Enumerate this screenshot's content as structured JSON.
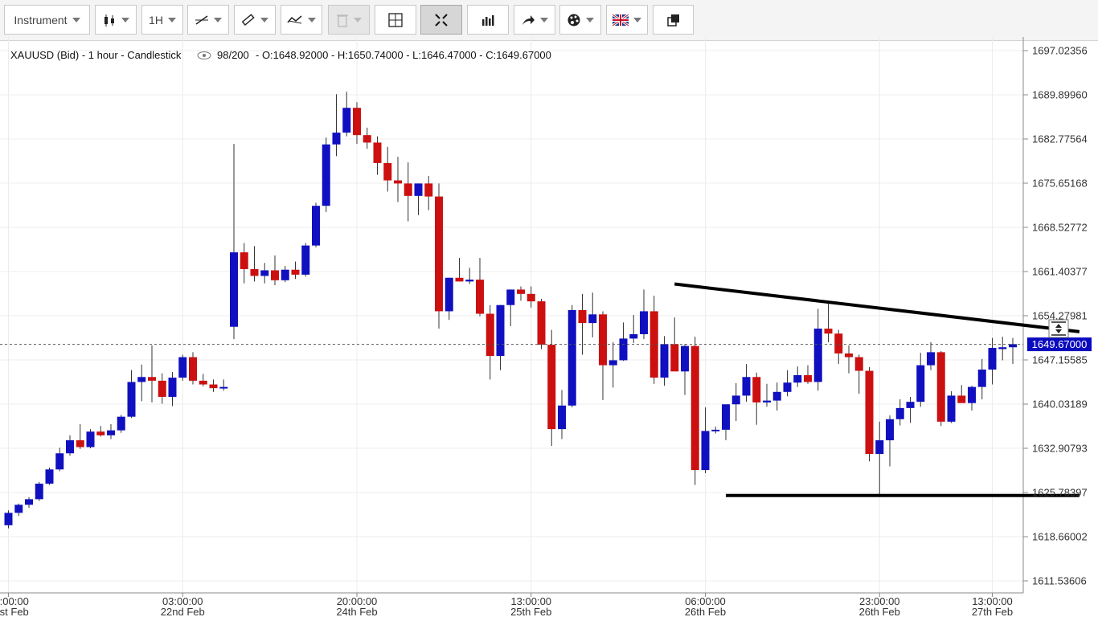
{
  "toolbar": {
    "instrument_label": "Instrument",
    "timeframe_label": "1H",
    "items": [
      "candle-style-icon",
      "line-tool-icon",
      "ruler-icon",
      "indicator-icon",
      "trash-icon",
      "crosshair-icon",
      "fullscreen-icon",
      "bars-icon",
      "arrow-icon",
      "palette-icon",
      "uk-flag-icon",
      "windows-icon"
    ]
  },
  "chart_info": {
    "header": "XAUUSD (Bid) - 1 hour - Candlestick",
    "counter": "98/200",
    "ohlc": "- O:1648.92000 - H:1650.74000 - L:1646.47000 - C:1649.67000"
  },
  "chart_data": {
    "type": "candlestick",
    "title": "XAUUSD (Bid) - 1 hour - Candlestick",
    "ylim": [
      1608,
      1700
    ],
    "y_ticks": [
      1697.02356,
      1689.8996,
      1682.77564,
      1675.65168,
      1668.52772,
      1661.40377,
      1654.27981,
      1647.15585,
      1640.03189,
      1632.90793,
      1625.78397,
      1618.66002,
      1611.53606
    ],
    "x_ticks": [
      {
        "time": "10:00:00",
        "date": "21st Feb",
        "index": 0
      },
      {
        "time": "03:00:00",
        "date": "22nd Feb",
        "index": 17
      },
      {
        "time": "20:00:00",
        "date": "24th Feb",
        "index": 34
      },
      {
        "time": "13:00:00",
        "date": "25th Feb",
        "index": 51
      },
      {
        "time": "06:00:00",
        "date": "26th Feb",
        "index": 68
      },
      {
        "time": "23:00:00",
        "date": "26th Feb",
        "index": 85
      },
      {
        "time": "13:00:00",
        "date": "27th Feb",
        "index": 96
      }
    ],
    "current_price": 1649.67,
    "current_price_label": "1649.67000",
    "up_color": "#1010c0",
    "down_color": "#cc1010",
    "candles": [
      [
        1620.5,
        1622.9,
        1620.0,
        1622.5
      ],
      [
        1622.5,
        1624.0,
        1622.0,
        1623.8
      ],
      [
        1623.8,
        1625.0,
        1623.3,
        1624.7
      ],
      [
        1624.7,
        1627.5,
        1624.4,
        1627.2
      ],
      [
        1627.2,
        1629.8,
        1627.0,
        1629.5
      ],
      [
        1629.5,
        1633.0,
        1629.2,
        1632.1
      ],
      [
        1632.1,
        1635.0,
        1631.7,
        1634.2
      ],
      [
        1634.2,
        1636.8,
        1632.8,
        1633.1
      ],
      [
        1633.1,
        1636.0,
        1632.9,
        1635.6
      ],
      [
        1635.6,
        1636.5,
        1634.8,
        1635.0
      ],
      [
        1635.0,
        1636.8,
        1634.4,
        1635.8
      ],
      [
        1635.8,
        1638.3,
        1635.4,
        1638.0
      ],
      [
        1638.0,
        1645.5,
        1637.8,
        1643.6
      ],
      [
        1643.6,
        1646.4,
        1640.5,
        1644.4
      ],
      [
        1644.4,
        1649.5,
        1640.3,
        1643.8
      ],
      [
        1643.8,
        1645.0,
        1640.1,
        1641.2
      ],
      [
        1641.2,
        1645.2,
        1639.7,
        1644.3
      ],
      [
        1644.3,
        1648.0,
        1643.8,
        1647.6
      ],
      [
        1647.6,
        1648.4,
        1643.2,
        1643.8
      ],
      [
        1643.8,
        1644.9,
        1642.9,
        1643.2
      ],
      [
        1643.2,
        1644.0,
        1642.0,
        1642.6
      ],
      [
        1642.6,
        1644.0,
        1642.2,
        1642.8
      ],
      [
        1652.5,
        1682.0,
        1650.5,
        1664.5
      ],
      [
        1664.5,
        1666.0,
        1659.5,
        1661.8
      ],
      [
        1661.8,
        1665.5,
        1659.8,
        1660.7
      ],
      [
        1660.7,
        1662.8,
        1659.5,
        1661.6
      ],
      [
        1661.6,
        1664.0,
        1659.2,
        1660.0
      ],
      [
        1660.0,
        1662.3,
        1659.7,
        1661.7
      ],
      [
        1661.7,
        1663.0,
        1660.2,
        1660.9
      ],
      [
        1660.9,
        1666.0,
        1660.6,
        1665.6
      ],
      [
        1665.6,
        1672.5,
        1665.3,
        1672.0
      ],
      [
        1672.0,
        1683.0,
        1671.0,
        1681.9
      ],
      [
        1681.9,
        1690.0,
        1680.0,
        1683.8
      ],
      [
        1683.8,
        1690.4,
        1683.2,
        1687.8
      ],
      [
        1687.8,
        1688.7,
        1682.0,
        1683.4
      ],
      [
        1683.4,
        1684.6,
        1681.2,
        1682.2
      ],
      [
        1682.2,
        1683.2,
        1677.0,
        1678.9
      ],
      [
        1678.9,
        1681.5,
        1674.3,
        1676.1
      ],
      [
        1676.1,
        1679.9,
        1672.6,
        1675.6
      ],
      [
        1675.6,
        1679.0,
        1669.5,
        1673.6
      ],
      [
        1673.6,
        1675.6,
        1670.5,
        1675.6
      ],
      [
        1675.6,
        1676.8,
        1671.3,
        1673.5
      ],
      [
        1673.5,
        1675.6,
        1652.2,
        1655.0
      ],
      [
        1655.0,
        1660.4,
        1653.6,
        1660.4
      ],
      [
        1660.4,
        1663.6,
        1659.8,
        1659.8
      ],
      [
        1659.8,
        1662.0,
        1659.4,
        1660.1
      ],
      [
        1660.1,
        1663.6,
        1654.2,
        1654.6
      ],
      [
        1654.6,
        1656.0,
        1644.0,
        1647.8
      ],
      [
        1647.8,
        1656.0,
        1645.5,
        1656.0
      ],
      [
        1656.0,
        1658.5,
        1652.6,
        1658.5
      ],
      [
        1658.5,
        1659.0,
        1656.7,
        1657.8
      ],
      [
        1657.8,
        1659.0,
        1655.6,
        1656.6
      ],
      [
        1656.6,
        1657.0,
        1648.9,
        1649.6
      ],
      [
        1649.6,
        1652.0,
        1633.3,
        1636.0
      ],
      [
        1636.0,
        1642.3,
        1634.4,
        1639.8
      ],
      [
        1639.8,
        1656.0,
        1639.5,
        1655.2
      ],
      [
        1655.2,
        1657.8,
        1648.0,
        1653.1
      ],
      [
        1653.1,
        1658.0,
        1650.8,
        1654.5
      ],
      [
        1654.5,
        1655.0,
        1640.7,
        1646.3
      ],
      [
        1646.3,
        1650.0,
        1642.7,
        1647.1
      ],
      [
        1647.1,
        1653.2,
        1647.0,
        1650.6
      ],
      [
        1650.6,
        1654.4,
        1649.9,
        1651.3
      ],
      [
        1651.3,
        1658.5,
        1650.5,
        1655.0
      ],
      [
        1655.0,
        1657.5,
        1643.3,
        1644.3
      ],
      [
        1644.3,
        1651.0,
        1643.0,
        1649.7
      ],
      [
        1649.7,
        1654.0,
        1646.0,
        1645.3
      ],
      [
        1645.3,
        1649.7,
        1641.5,
        1649.4
      ],
      [
        1649.4,
        1650.9,
        1627.0,
        1629.4
      ],
      [
        1629.4,
        1639.5,
        1628.9,
        1635.7
      ],
      [
        1635.7,
        1636.4,
        1635.3,
        1635.9
      ],
      [
        1635.9,
        1639.6,
        1634.2,
        1640.0
      ],
      [
        1640.0,
        1643.4,
        1637.3,
        1641.4
      ],
      [
        1641.4,
        1646.5,
        1640.4,
        1644.4
      ],
      [
        1644.4,
        1645.1,
        1636.7,
        1640.3
      ],
      [
        1640.3,
        1643.3,
        1639.6,
        1640.6
      ],
      [
        1640.6,
        1643.5,
        1639.0,
        1642.0
      ],
      [
        1642.0,
        1645.5,
        1641.3,
        1643.5
      ],
      [
        1643.5,
        1646.1,
        1642.8,
        1644.7
      ],
      [
        1644.7,
        1646.3,
        1643.3,
        1643.6
      ],
      [
        1643.6,
        1655.4,
        1642.2,
        1652.2
      ],
      [
        1652.2,
        1656.5,
        1650.0,
        1651.4
      ],
      [
        1651.4,
        1652.0,
        1646.5,
        1648.2
      ],
      [
        1648.2,
        1649.5,
        1645.0,
        1647.6
      ],
      [
        1647.6,
        1648.0,
        1641.7,
        1645.4
      ],
      [
        1645.4,
        1646.0,
        1630.8,
        1632.0
      ],
      [
        1632.0,
        1637.2,
        1625.5,
        1634.2
      ],
      [
        1634.2,
        1638.2,
        1630.0,
        1637.6
      ],
      [
        1637.6,
        1640.8,
        1636.6,
        1639.4
      ],
      [
        1639.4,
        1641.2,
        1637.0,
        1640.4
      ],
      [
        1640.4,
        1648.3,
        1639.6,
        1646.3
      ],
      [
        1646.3,
        1650.0,
        1645.5,
        1648.4
      ],
      [
        1648.4,
        1648.6,
        1636.5,
        1637.2
      ],
      [
        1637.2,
        1642.1,
        1637.0,
        1641.4
      ],
      [
        1641.4,
        1643.1,
        1640.8,
        1640.2
      ],
      [
        1640.2,
        1643.0,
        1639.0,
        1642.8
      ],
      [
        1642.8,
        1647.3,
        1640.8,
        1645.6
      ],
      [
        1645.6,
        1650.7,
        1643.2,
        1649.1
      ],
      [
        1648.9,
        1650.9,
        1647.1,
        1649.2
      ],
      [
        1649.2,
        1650.7,
        1646.5,
        1649.7
      ]
    ],
    "trendlines": [
      {
        "name": "resistance",
        "x1": 65,
        "y1": 1659.4,
        "x2": 104.5,
        "y2": 1651.7
      },
      {
        "name": "support",
        "x1": 70,
        "y1": 1625.3,
        "x2": 104.5,
        "y2": 1625.3
      }
    ]
  }
}
